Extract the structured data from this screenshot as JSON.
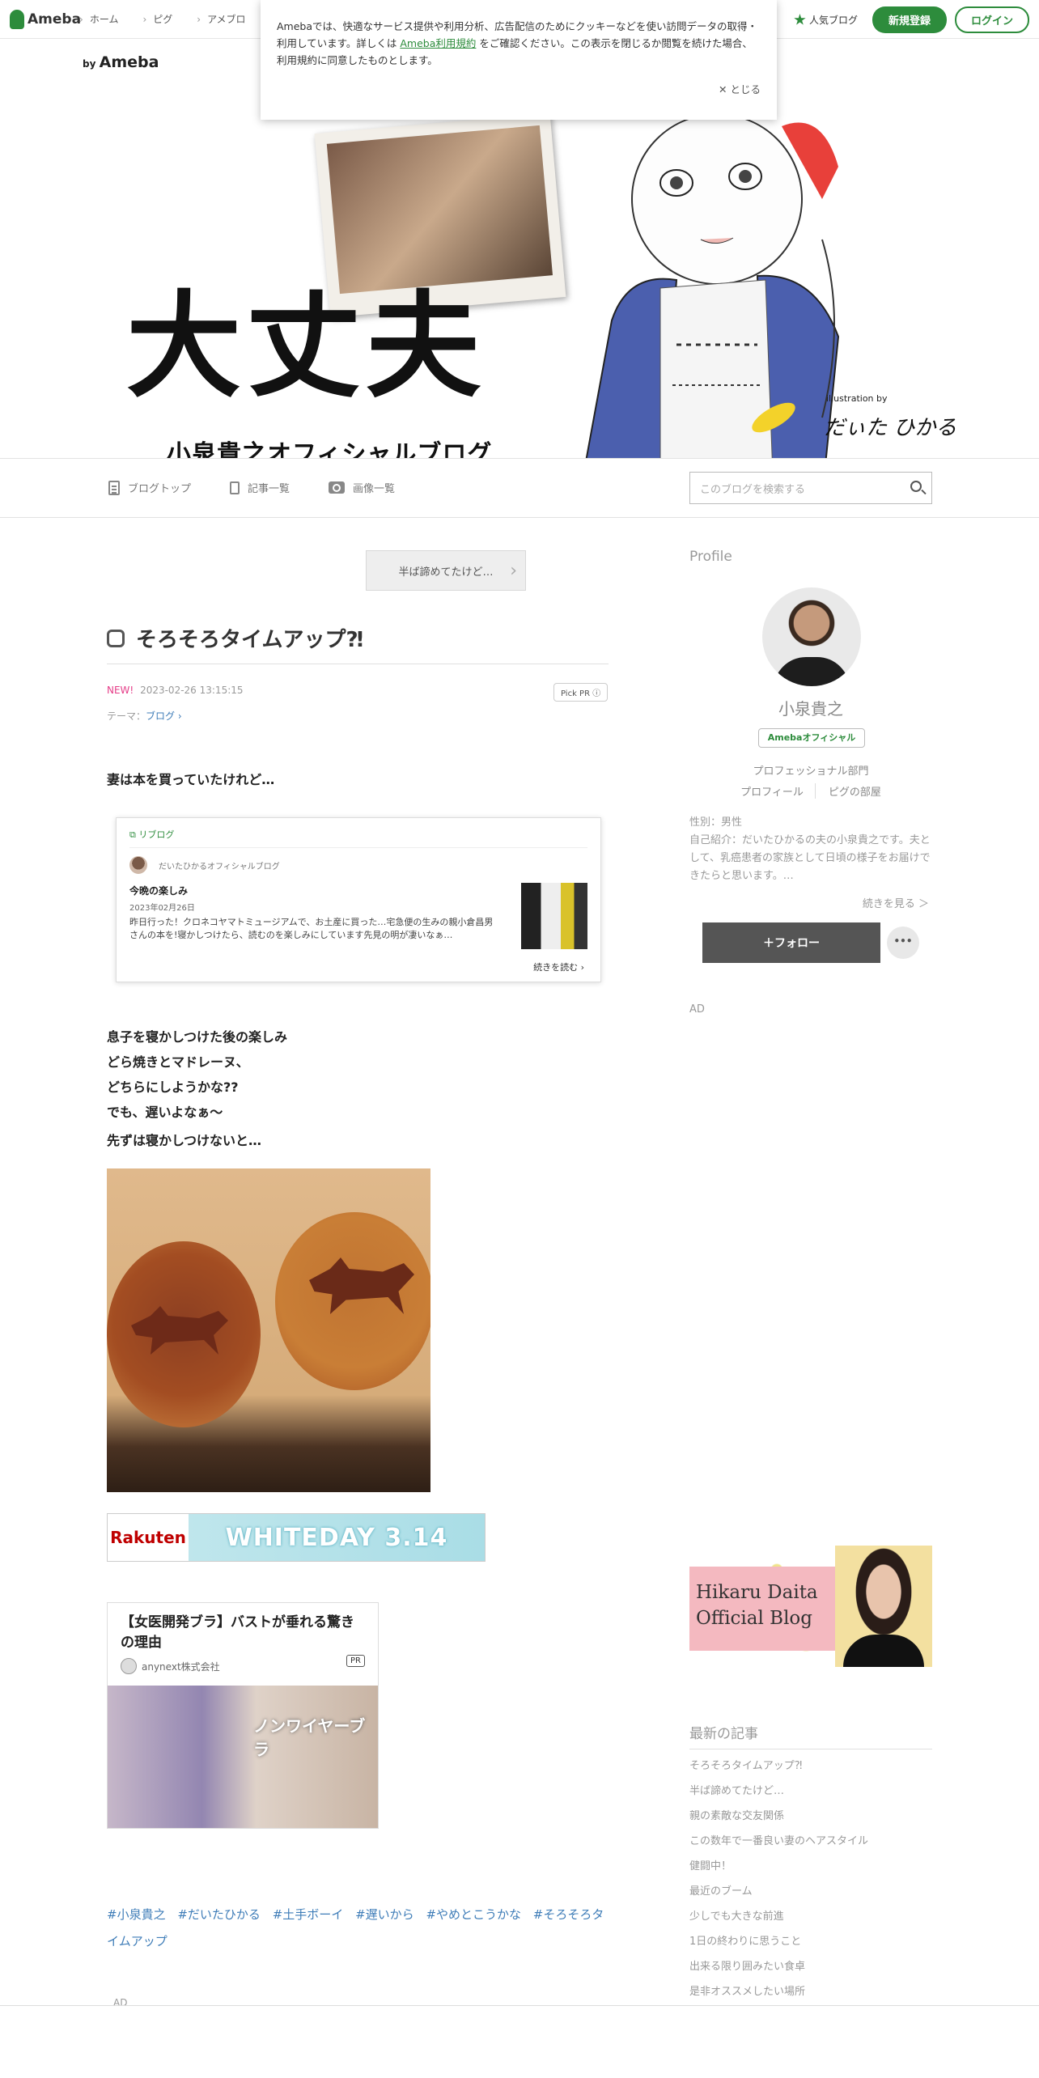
{
  "topbar": {
    "logo_text": "Ameba",
    "nav": [
      "ホーム",
      "ピグ",
      "アメブロ"
    ],
    "popular_label": "人気ブログ",
    "signup_label": "新規登録",
    "login_label": "ログイン"
  },
  "cookie": {
    "text1": "Amebaでは、快適なサービス提供や利用分析、広告配信のためにクッキーなどを使い訪問データの取得・利用しています。詳しくは",
    "link": "Ameba利用規約",
    "text2": "をご確認ください。この表示を閉じるか閲覧を続けた場合、利用規約に同意したものとします。",
    "close_label": "✕ とじる"
  },
  "header": {
    "by_ameba_prefix": "by",
    "by_ameba": "Ameba",
    "title": "大丈夫",
    "subtitle": "小泉貴之オフィシャルブログ",
    "illustration_by": "illustration by",
    "illustrator": "だぃた ひかる"
  },
  "blognav": {
    "items": [
      "ブログトップ",
      "記事一覧",
      "画像一覧"
    ],
    "search_placeholder": "このブログを検索する"
  },
  "entry": {
    "prev_label": "半ば諦めてたけど…",
    "title": "そろそろタイムアップ⁈",
    "new_badge": "NEW!",
    "datetime": "2023-02-26 13:15:15",
    "pickpr": "Pick PR ⓘ",
    "theme_prefix": "テーマ：",
    "theme": "ブログ ›",
    "para1": "妻は本を買っていたけれど…",
    "reblog": {
      "label": "リブログ",
      "author": "だいたひかるオフィシャルブログ",
      "title": "今晩の楽しみ",
      "date": "2023年02月26日",
      "body": "昨日行った！クロネコヤマトミュージアムで、お土産に買った…宅急便の生みの親小倉昌男さんの本を!寝かしつけたら、読むのを楽しみにしています先見の明が凄いなぁ…",
      "more": "続きを読む ›"
    },
    "lines": [
      "息子を寝かしつけた後の楽しみ",
      "どら焼きとマドレーヌ、",
      "どちらにしようかな??",
      "でも、遅いよなぁ〜"
    ],
    "para2": "先ずは寝かしつけないと…",
    "rakuten": {
      "logo": "Rakuten",
      "banner": "WHITEDAY 3.14"
    },
    "ad": {
      "title": "【女医開発ブラ】バストが垂れる驚きの理由",
      "company": "anynext株式会社",
      "pr": "PR",
      "img_text": "ノンワイヤーブラ"
    },
    "hashtags": [
      "#小泉貴之",
      "#だいたひかる",
      "#土手ボーイ",
      "#遅いから",
      "#やめとこうかな",
      "#そろそろタイムアップ"
    ],
    "ad_label": "AD"
  },
  "sidebar": {
    "profile_heading": "Profile",
    "name": "小泉貴之",
    "official_badge": "Amebaオフィシャル",
    "dept": "プロフェッショナル部門",
    "links": [
      "プロフィール",
      "ピグの部屋"
    ],
    "profile_text": "性別：男性\n自己紹介：だいたひかるの夫の小泉貴之です。夫として、乳癌患者の家族として日頃の様子をお届けできたらと思います。…",
    "more_label": "続きを見る ＞",
    "follow_label": "＋フォロー",
    "dots_label": "•••",
    "ad_label": "AD",
    "banner_text": "Hikaru Daita Official Blog",
    "latest_heading": "最新の記事",
    "latest": [
      "そろそろタイムアップ⁈",
      "半ば諦めてたけど…",
      "親の素敵な交友関係",
      "この数年で一番良い妻のヘアスタイル",
      "健闘中！",
      "最近のブーム",
      "少しでも大きな前進",
      "1日の終わりに思うこと",
      "出来る限り囲みたい食卓",
      "是非オススメしたい場所"
    ]
  }
}
